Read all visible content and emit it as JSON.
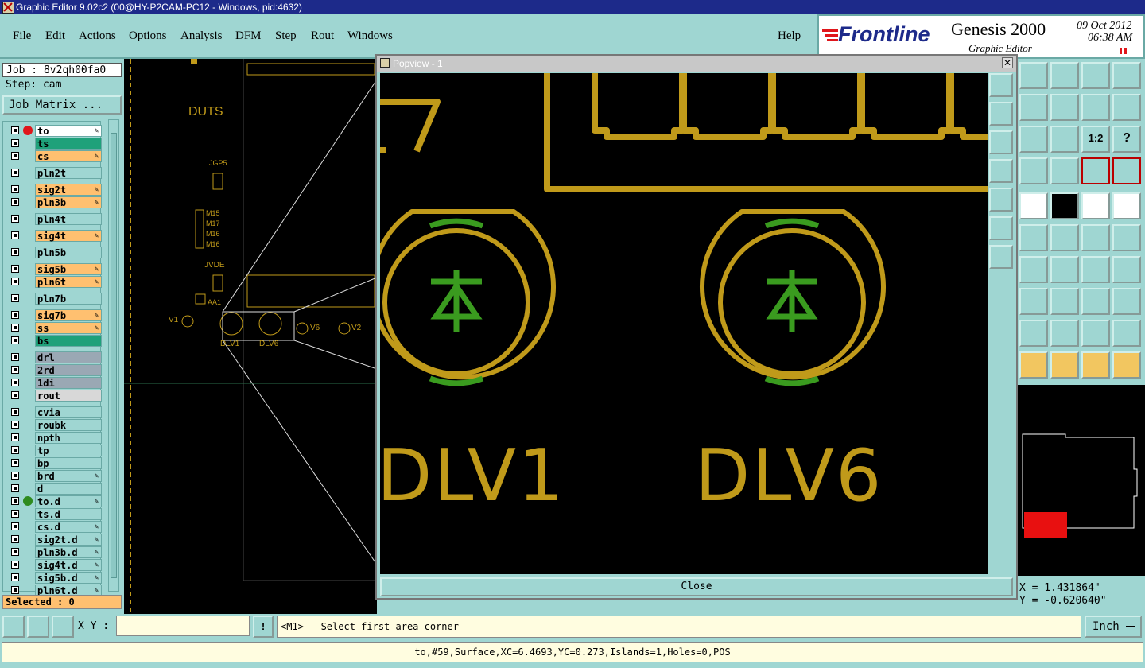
{
  "titlebar": {
    "title": "Graphic Editor 9.02c2 (00@HY-P2CAM-PC12 - Windows, pid:4632)"
  },
  "menu": {
    "items": [
      "File",
      "Edit",
      "Actions",
      "Options",
      "Analysis",
      "DFM",
      "Step",
      "Rout",
      "Windows"
    ],
    "help": "Help"
  },
  "logo": {
    "brand": "Frontline",
    "product": "Genesis 2000",
    "subtitle": "Graphic Editor",
    "date": "09 Oct 2012",
    "time": "06:38 AM"
  },
  "left": {
    "job": "Job : 8v2qh00fa0",
    "step": "Step: cam",
    "job_matrix": "Job Matrix ...",
    "selected": "Selected : 0",
    "layers": [
      {
        "name": "to",
        "color": "#ffffff",
        "edit": true,
        "active": "#e0161b"
      },
      {
        "name": "ts",
        "color": "#1fa17a",
        "edit": false
      },
      {
        "name": "cs",
        "color": "#ffc070",
        "edit": true
      },
      {
        "name": "pln2t",
        "color": "#9fd6d2",
        "edit": false
      },
      {
        "name": "sig2t",
        "color": "#ffc070",
        "edit": true
      },
      {
        "name": "pln3b",
        "color": "#ffc070",
        "edit": true
      },
      {
        "name": "pln4t",
        "color": "#9fd6d2",
        "edit": false
      },
      {
        "name": "sig4t",
        "color": "#ffc070",
        "edit": true
      },
      {
        "name": "pln5b",
        "color": "#9fd6d2",
        "edit": false
      },
      {
        "name": "sig5b",
        "color": "#ffc070",
        "edit": true
      },
      {
        "name": "pln6t",
        "color": "#ffc070",
        "edit": true
      },
      {
        "name": "pln7b",
        "color": "#9fd6d2",
        "edit": false
      },
      {
        "name": "sig7b",
        "color": "#ffc070",
        "edit": true
      },
      {
        "name": "ss",
        "color": "#ffc070",
        "edit": true
      },
      {
        "name": "bs",
        "color": "#1fa17a",
        "edit": false
      },
      {
        "name": "drl",
        "color": "#9aa8b4",
        "edit": false
      },
      {
        "name": "2rd",
        "color": "#9aa8b4",
        "edit": false
      },
      {
        "name": "1di",
        "color": "#9aa8b4",
        "edit": false
      },
      {
        "name": "rout",
        "color": "#d8d8d8",
        "edit": false
      },
      {
        "name": "cvia",
        "color": "#9fd6d2",
        "edit": false
      },
      {
        "name": "roubk",
        "color": "#9fd6d2",
        "edit": false
      },
      {
        "name": "npth",
        "color": "#9fd6d2",
        "edit": false
      },
      {
        "name": "tp",
        "color": "#9fd6d2",
        "edit": false
      },
      {
        "name": "bp",
        "color": "#9fd6d2",
        "edit": false
      },
      {
        "name": "brd",
        "color": "#9fd6d2",
        "edit": true
      },
      {
        "name": "d",
        "color": "#9fd6d2",
        "edit": false
      },
      {
        "name": "to.d",
        "color": "#9fd6d2",
        "edit": true,
        "active": "#2e8b1e"
      },
      {
        "name": "ts.d",
        "color": "#9fd6d2",
        "edit": false
      },
      {
        "name": "cs.d",
        "color": "#9fd6d2",
        "edit": true
      },
      {
        "name": "sig2t.d",
        "color": "#9fd6d2",
        "edit": true
      },
      {
        "name": "pln3b.d",
        "color": "#9fd6d2",
        "edit": true
      },
      {
        "name": "sig4t.d",
        "color": "#9fd6d2",
        "edit": true
      },
      {
        "name": "sig5b.d",
        "color": "#9fd6d2",
        "edit": true
      },
      {
        "name": "pln6t.d",
        "color": "#9fd6d2",
        "edit": true
      }
    ]
  },
  "canvas": {
    "labels": [
      "DUTS",
      "JGP5",
      "M15",
      "M17",
      "M16",
      "M16",
      "JVDE",
      "AA1",
      "V1",
      "V6",
      "V2",
      "DLV1",
      "DLV6"
    ]
  },
  "popview": {
    "title": "Popview - 1",
    "close": "Close",
    "labels": [
      "DLV1",
      "DLV6"
    ],
    "digit": "7"
  },
  "toolbox": {
    "scale_label": "1:2",
    "help_glyph": "?"
  },
  "coords": {
    "x": "X = 1.431864\"",
    "y": "Y = -0.620640\""
  },
  "cmd": {
    "xy_label": "X Y :",
    "xy_value": "",
    "prompt": "<M1> - Select first area corner",
    "units": "Inch"
  },
  "status": {
    "text": "to,#59,Surface,XC=6.4693,YC=0.273,Islands=1,Holes=0,POS"
  },
  "colors": {
    "pad": "#c09a1a",
    "copper": "#3a9b1f",
    "accent": "#1d2a8a",
    "panel": "#9fd6d2"
  }
}
